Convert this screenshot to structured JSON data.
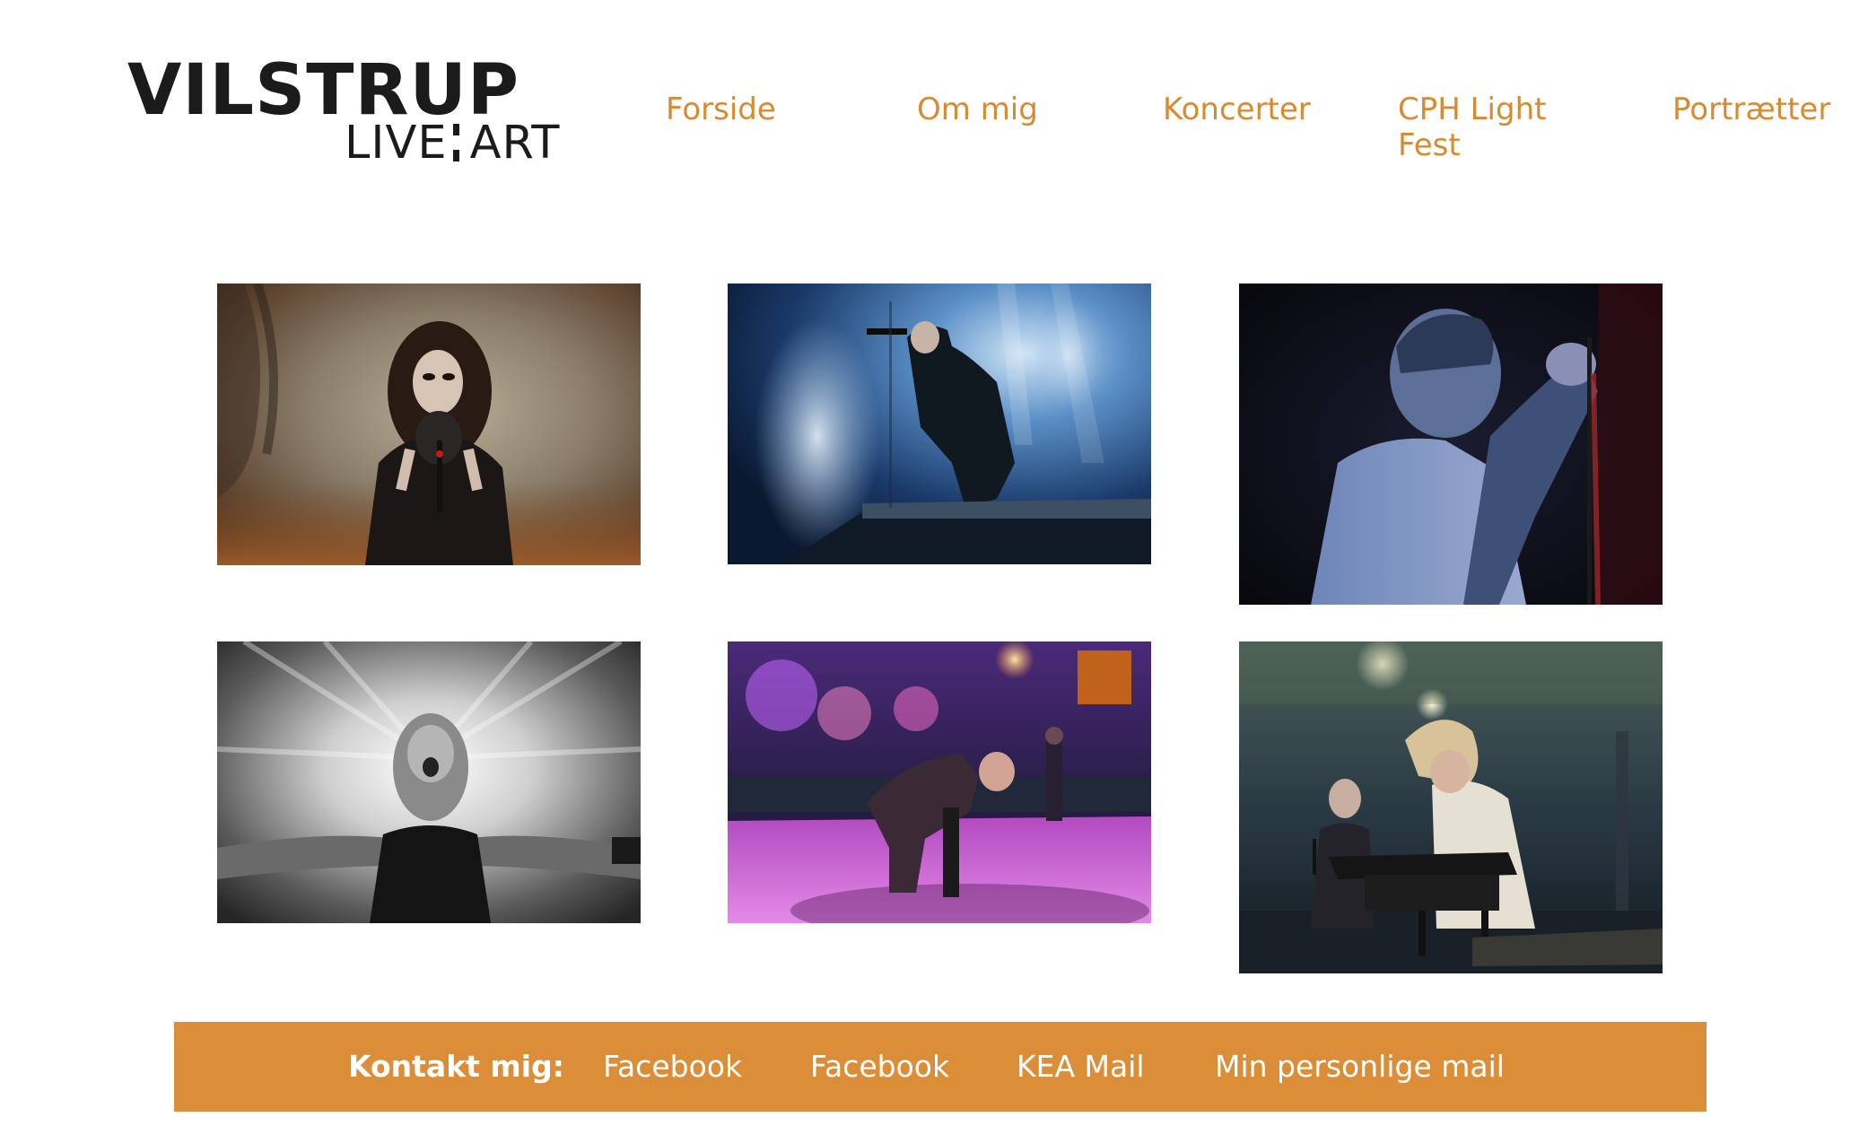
{
  "logo": {
    "line1": "VILSTRUP",
    "line2_left": "LIVE",
    "line2_right": "ART"
  },
  "nav": {
    "items": [
      {
        "label": "Forside"
      },
      {
        "label": "Om mig"
      },
      {
        "label": "Koncerter"
      },
      {
        "label": "CPH Light Fest"
      },
      {
        "label": "Portrætter"
      }
    ]
  },
  "gallery": {
    "photos": [
      {
        "subject": "singer-with-microphone-smoky-orange-stage"
      },
      {
        "subject": "singer-on-stage-riser-blue-smoke"
      },
      {
        "subject": "singer-close-up-blue-red-light"
      },
      {
        "subject": "black-white-singer-arms-outstretched"
      },
      {
        "subject": "singer-kneeling-purple-stage"
      },
      {
        "subject": "two-performers-keyboard-outdoor-stage"
      }
    ]
  },
  "footer": {
    "label": "Kontakt mig:",
    "links": [
      {
        "label": "Facebook"
      },
      {
        "label": "Facebook"
      },
      {
        "label": "KEA Mail"
      },
      {
        "label": "Min personlige mail"
      }
    ]
  },
  "colors": {
    "accent": "#dc8d38",
    "nav_text": "#d88a33",
    "logo_text": "#1b1b1b",
    "footer_text": "#ffffff"
  }
}
